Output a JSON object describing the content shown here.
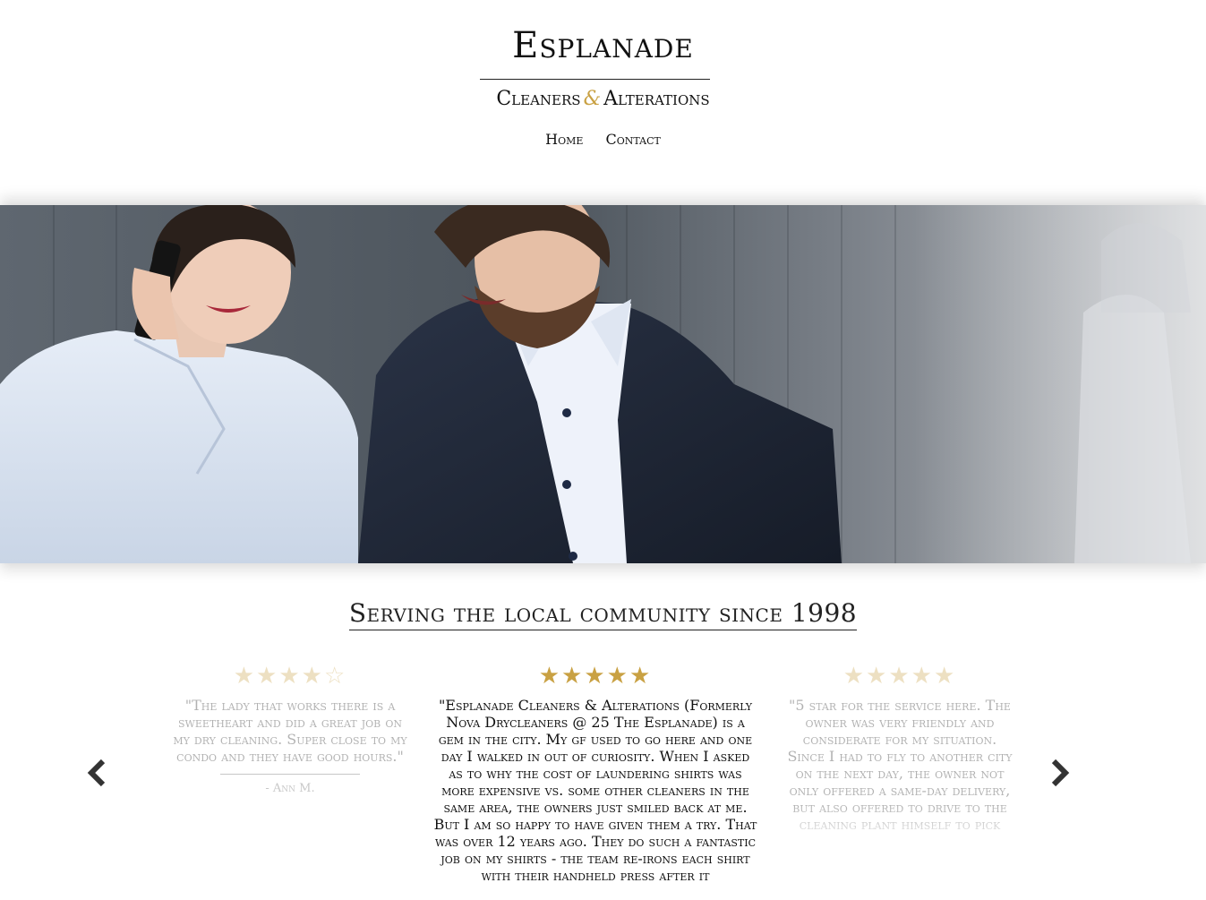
{
  "brand": {
    "title": "Esplanade",
    "subtitle_left": "Cleaners",
    "subtitle_amp": "&",
    "subtitle_right": "Alterations"
  },
  "nav": {
    "items": [
      {
        "label": "Home"
      },
      {
        "label": "Contact"
      }
    ]
  },
  "hero": {
    "alt": "Smiling woman on phone and laughing man in suit"
  },
  "tagline": "Serving the local community since 1998",
  "reviews": [
    {
      "stars": "★★★★☆",
      "text": "\"The lady that works there is a sweetheart and did a great job on my dry cleaning. Super close to my condo and they have good hours.\"",
      "author": "- Ann M."
    },
    {
      "stars": "★★★★★",
      "text": "\"Esplanade Cleaners & Alterations (Formerly Nova Drycleaners @ 25 The Esplanade) is a gem in the city. My gf used to go here and one day I walked in out of curiosity. When I asked as to why the cost of laundering shirts was more expensive vs. some other cleaners in the same area, the owners just smiled back at me. But I am so happy to have given them a try. That was over 12 years ago. They do such a fantastic job on my shirts - the team re-irons each shirt with their handheld press after it",
      "author": ""
    },
    {
      "stars": "★★★★★",
      "text": "\"5 star for the service here. The owner was very friendly and considerate for my situation. Since I had to fly to another city on the next day, the owner not only offered a same-day delivery, but also offered to drive to the cleaning plant himself to pick",
      "author": ""
    }
  ],
  "carousel": {
    "prev": "chevron-left-icon",
    "next": "chevron-right-icon"
  },
  "colors": {
    "accent_gold": "#c9a143",
    "text": "#111111"
  }
}
